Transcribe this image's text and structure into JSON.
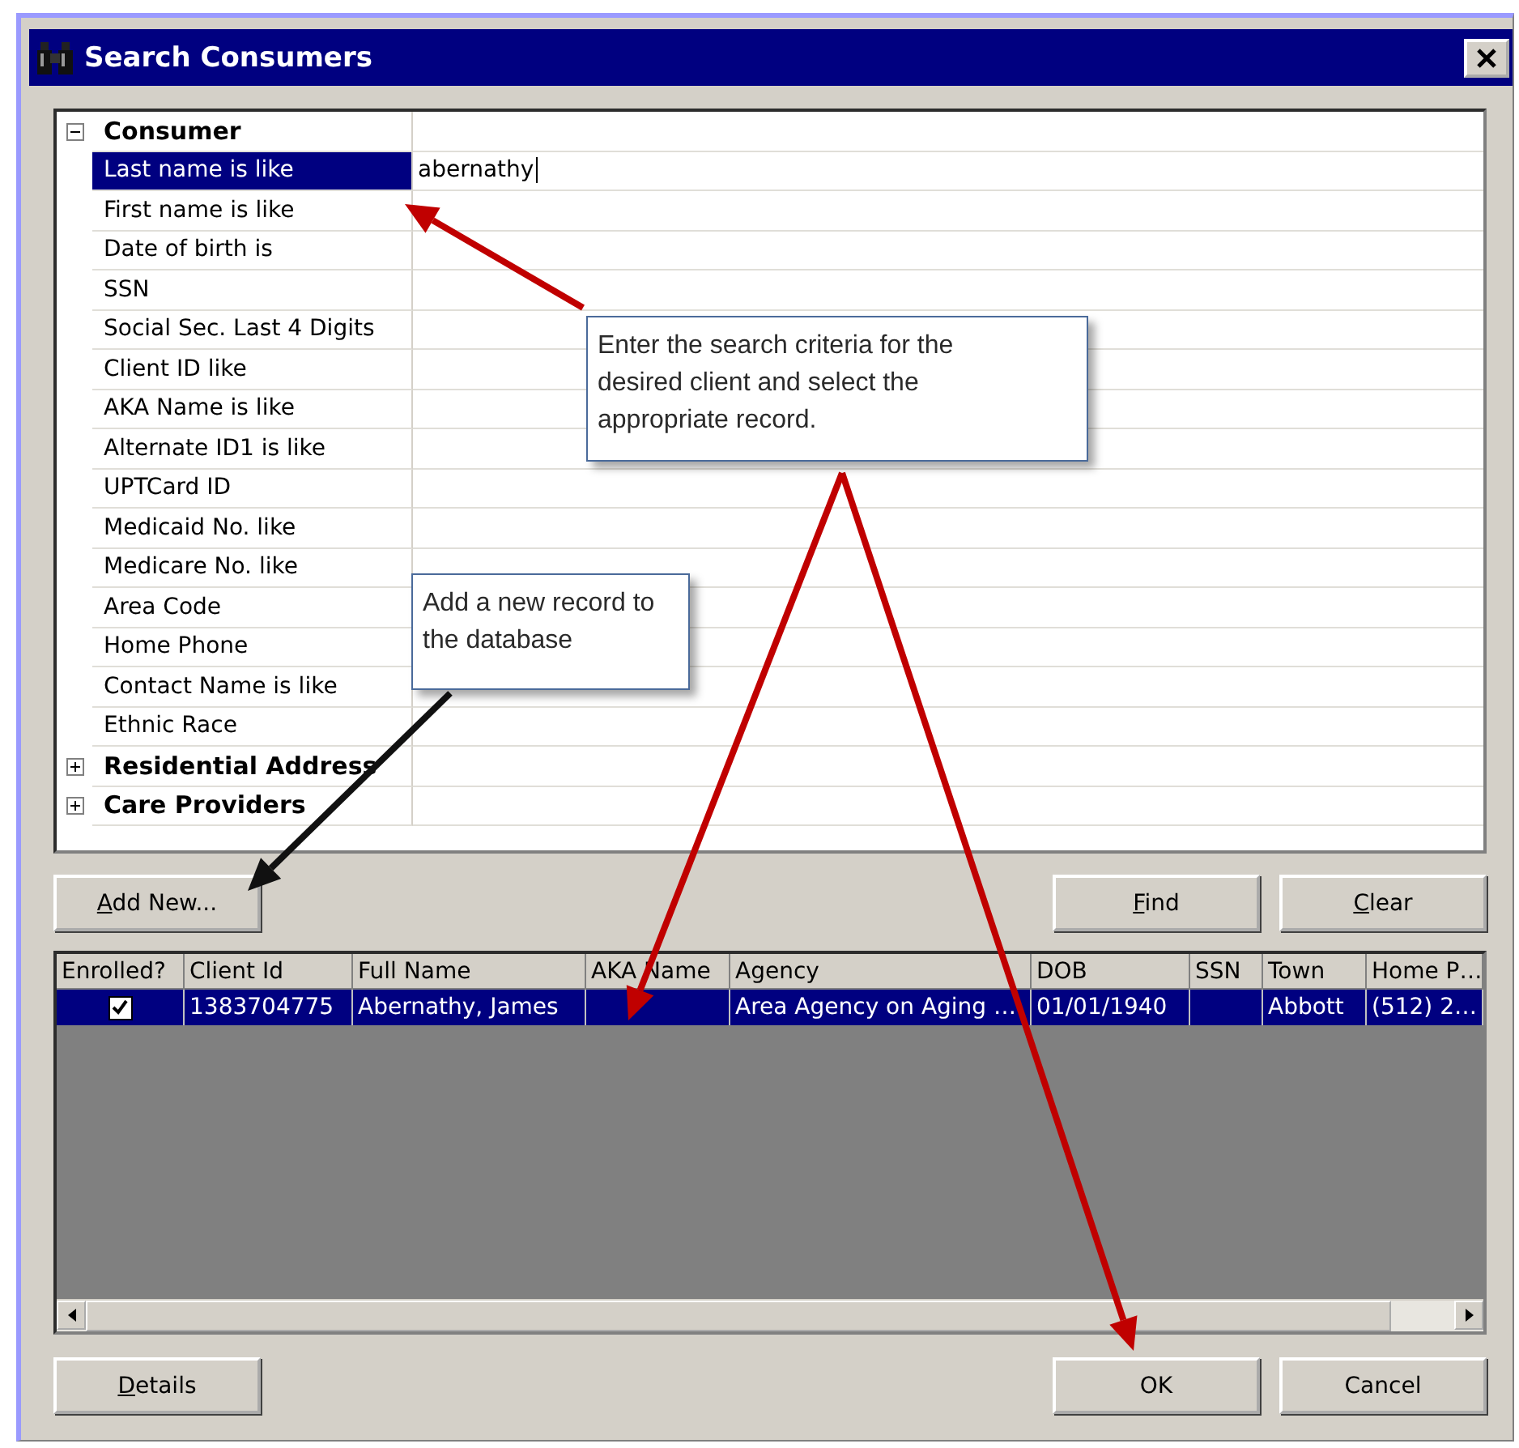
{
  "window": {
    "title": "Search Consumers"
  },
  "criteria": [
    {
      "label": "Consumer",
      "expanded": true,
      "children": [
        {
          "label": "Last name is like",
          "value": "abernathy",
          "selected": true
        },
        {
          "label": "First name is like",
          "selected": false
        },
        {
          "label": "Date of birth is",
          "selected": false
        },
        {
          "label": "SSN",
          "selected": false
        },
        {
          "label": "Social Sec. Last 4 Digits",
          "selected": false
        },
        {
          "label": "Client ID like",
          "selected": false
        },
        {
          "label": "AKA Name is like",
          "selected": false
        },
        {
          "label": "Alternate ID1 is like",
          "selected": false
        },
        {
          "label": "UPTCard ID",
          "selected": false
        },
        {
          "label": "Medicaid No. like",
          "selected": false
        },
        {
          "label": "Medicare No. like",
          "selected": false
        },
        {
          "label": "Area Code",
          "selected": false
        },
        {
          "label": "Home Phone",
          "selected": false
        },
        {
          "label": "Contact Name is like",
          "selected": false
        },
        {
          "label": "Ethnic Race",
          "selected": false
        }
      ]
    },
    {
      "label": "Residential Address",
      "expanded": false
    },
    {
      "label": "Care Providers",
      "expanded": false
    }
  ],
  "search_buttons": [
    {
      "label": "Add New...",
      "mnemonic": true
    },
    {
      "label": "Find",
      "mnemonic": true
    },
    {
      "label": "Clear",
      "mnemonic": true
    }
  ],
  "results": {
    "columns": [
      "Enrolled?",
      "Client Id",
      "Full Name",
      "AKA Name",
      "Agency",
      "DOB",
      "SSN",
      "Town",
      "Home P…"
    ],
    "rows": [
      {
        "enrolled": true,
        "selected": true,
        "cells": [
          "",
          "1383704775",
          "Abernathy, James",
          "",
          "Area Agency on Aging …",
          "01/01/1940",
          "",
          "Abbott",
          "(512) 2…"
        ]
      }
    ]
  },
  "footer_buttons": [
    {
      "label": "Details",
      "mnemonic": true
    },
    {
      "label": "OK",
      "mnemonic": false
    },
    {
      "label": "Cancel",
      "mnemonic": false
    }
  ],
  "callouts": [
    {
      "text": "Enter the search criteria for the desired client and select the appropriate record."
    },
    {
      "text": "Add a new record to the database"
    }
  ]
}
